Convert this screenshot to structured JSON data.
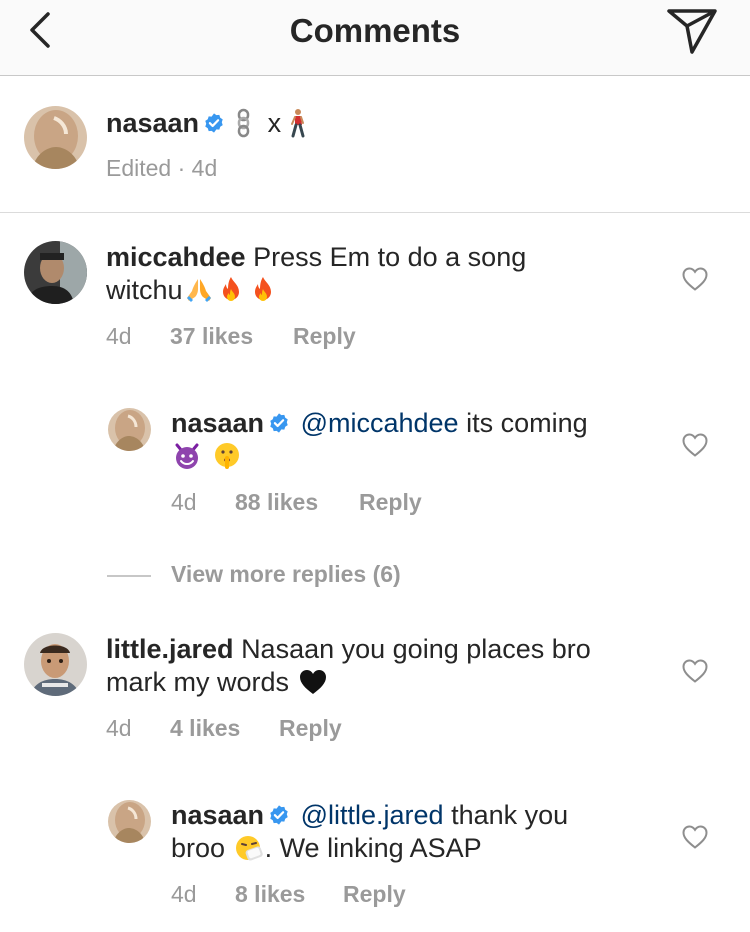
{
  "header": {
    "title": "Comments"
  },
  "caption": {
    "username": "nasaan",
    "text_x": "x",
    "edited": "Edited · 4d"
  },
  "comments": [
    {
      "username": "miccahdee",
      "text_line1": "Press Em to do a song",
      "text_line2": "witchu",
      "time": "4d",
      "likes": "37 likes",
      "reply": "Reply"
    },
    {
      "username": "nasaan",
      "mention": "@miccahdee",
      "text_line1": "its coming",
      "time": "4d",
      "likes": "88 likes",
      "reply": "Reply"
    },
    {
      "username": "little.jared",
      "text_line1": "Nasaan you going places bro",
      "text_line2": "mark my words",
      "time": "4d",
      "likes": "4 likes",
      "reply": "Reply"
    },
    {
      "username": "nasaan",
      "mention": "@little.jared",
      "text_line1": "thank you",
      "text_line2a": "broo",
      "text_line2b": ". We linking ASAP",
      "time": "4d",
      "likes": "8 likes",
      "reply": "Reply"
    }
  ],
  "view_more": "View more replies (6)",
  "colors": {
    "verified": "#3897f0",
    "mention": "#003569",
    "muted": "#9a9a9a"
  },
  "icons": [
    "back-arrow-icon",
    "direct-send-icon",
    "verified-badge-icon",
    "heart-icon"
  ]
}
